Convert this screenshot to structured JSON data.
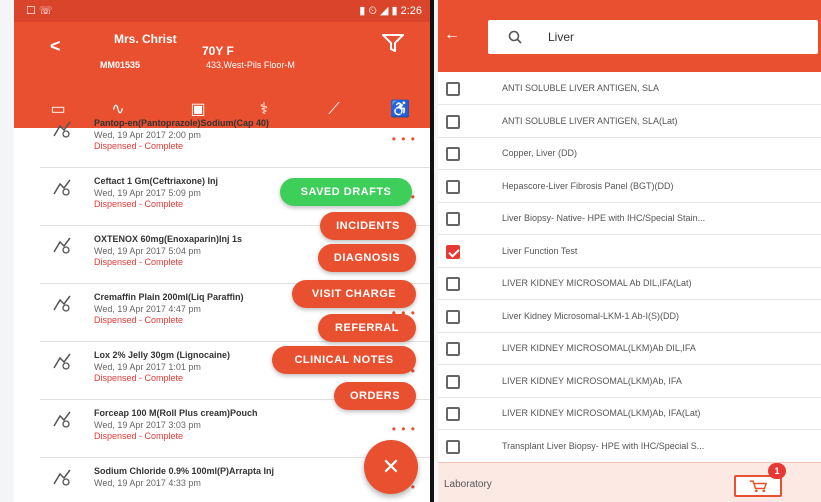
{
  "statusbar": {
    "left": "☐ ☏",
    "right": "▮ ⏲ ◢ ▮ 2:26"
  },
  "patient": {
    "name": "Mrs. Christ",
    "age_gender": "70Y F",
    "mrn": "MM01535",
    "location": "433,West-Pils Floor-M"
  },
  "tabs": [
    "card-icon",
    "pulse-icon",
    "clipboard-icon",
    "steth-icon",
    "syringe-icon",
    "person-icon"
  ],
  "orders": [
    {
      "title": "Pantop-en(Pantoprazole)Sodium(Cap 40)",
      "date": "Wed, 19 Apr 2017 2:00 pm",
      "status": "Dispensed - Complete"
    },
    {
      "title": "Ceftact 1 Gm(Ceftriaxone) Inj",
      "date": "Wed, 19 Apr 2017 5:09 pm",
      "status": "Dispensed - Complete"
    },
    {
      "title": "OXTENOX 60mg(Enoxaparin)Inj 1s",
      "date": "Wed, 19 Apr 2017 5:04 pm",
      "status": "Dispensed - Complete"
    },
    {
      "title": "Cremaffin Plain 200ml(Liq Paraffin)",
      "date": "Wed, 19 Apr 2017 4:47 pm",
      "status": "Dispensed - Complete"
    },
    {
      "title": "Lox 2% Jelly 30gm (Lignocaine)",
      "date": "Wed, 19 Apr 2017 1:01 pm",
      "status": "Dispensed - Complete"
    },
    {
      "title": "Forceap 100 M(Roll Plus cream)Pouch",
      "date": "Wed, 19 Apr 2017 3:03 pm",
      "status": "Dispensed - Complete"
    },
    {
      "title": "Sodium Chloride 0.9% 100ml(P)Arrapta Inj",
      "date": "Wed, 19 Apr 2017 4:33 pm",
      "status": ""
    }
  ],
  "actions": [
    {
      "label": "SAVED DRAFTS",
      "color": "#3ecf5b"
    },
    {
      "label": "INCIDENTS",
      "color": "#e8502f"
    },
    {
      "label": "DIAGNOSIS",
      "color": "#e8502f"
    },
    {
      "label": "VISIT CHARGE",
      "color": "#e8502f"
    },
    {
      "label": "REFERRAL",
      "color": "#e8502f"
    },
    {
      "label": "CLINICAL NOTES",
      "color": "#e8502f"
    },
    {
      "label": "ORDERS",
      "color": "#e8502f"
    }
  ],
  "fab": {
    "label": "✕"
  },
  "search": {
    "value": "Liver"
  },
  "results": [
    {
      "label": "ANTI SOLUBLE LIVER ANTIGEN, SLA",
      "checked": false
    },
    {
      "label": "ANTI SOLUBLE LIVER ANTIGEN, SLA(Lat)",
      "checked": false
    },
    {
      "label": "Copper, Liver (DD)",
      "checked": false
    },
    {
      "label": "Hepascore-Liver Fibrosis Panel (BGT)(DD)",
      "checked": false
    },
    {
      "label": "Liver Biopsy- Native- HPE with IHC/Special Stain...",
      "checked": false
    },
    {
      "label": "Liver Function Test",
      "checked": true
    },
    {
      "label": "LIVER KIDNEY MICROSOMAL Ab DIL,IFA(Lat)",
      "checked": false
    },
    {
      "label": "Liver Kidney Microsomal-LKM-1 Ab-I(S)(DD)",
      "checked": false
    },
    {
      "label": "LIVER KIDNEY MICROSOMAL(LKM)Ab DIL,IFA",
      "checked": false
    },
    {
      "label": "LIVER KIDNEY MICROSOMAL(LKM)Ab, IFA",
      "checked": false
    },
    {
      "label": "LIVER KIDNEY MICROSOMAL(LKM)Ab, IFA(Lat)",
      "checked": false
    },
    {
      "label": "Transplant Liver Biopsy- HPE with IHC/Special S...",
      "checked": false
    }
  ],
  "footer": {
    "label": "Laboratory",
    "cart_count": "1"
  }
}
